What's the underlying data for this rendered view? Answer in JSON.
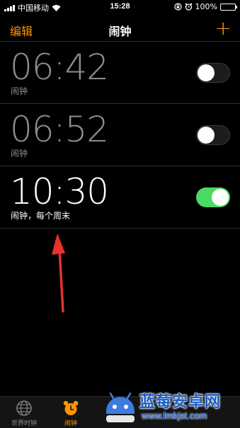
{
  "status_bar": {
    "carrier": "中国移动",
    "time": "15:28",
    "battery": "100%"
  },
  "nav": {
    "edit_label": "编辑",
    "title": "闹钟",
    "add_label": "+"
  },
  "alarms": [
    {
      "time": "06:42",
      "label": "闹钟",
      "enabled": false
    },
    {
      "time": "06:52",
      "label": "闹钟",
      "enabled": false
    },
    {
      "time": "10:30",
      "label": "闹钟，每个周末",
      "enabled": true
    }
  ],
  "tabs": [
    {
      "label": "世界时钟",
      "icon": "globe-icon",
      "selected": false
    },
    {
      "label": "闹钟",
      "icon": "alarm-clock-icon",
      "selected": true
    }
  ],
  "watermark": {
    "title": "蓝莓安卓网",
    "url": "www.lmkjst.com"
  },
  "colors": {
    "accent": "#ff9500",
    "toggle_on": "#4cd964",
    "annotation_arrow": "#e8322b",
    "watermark_blue": "#1a5cc8"
  }
}
